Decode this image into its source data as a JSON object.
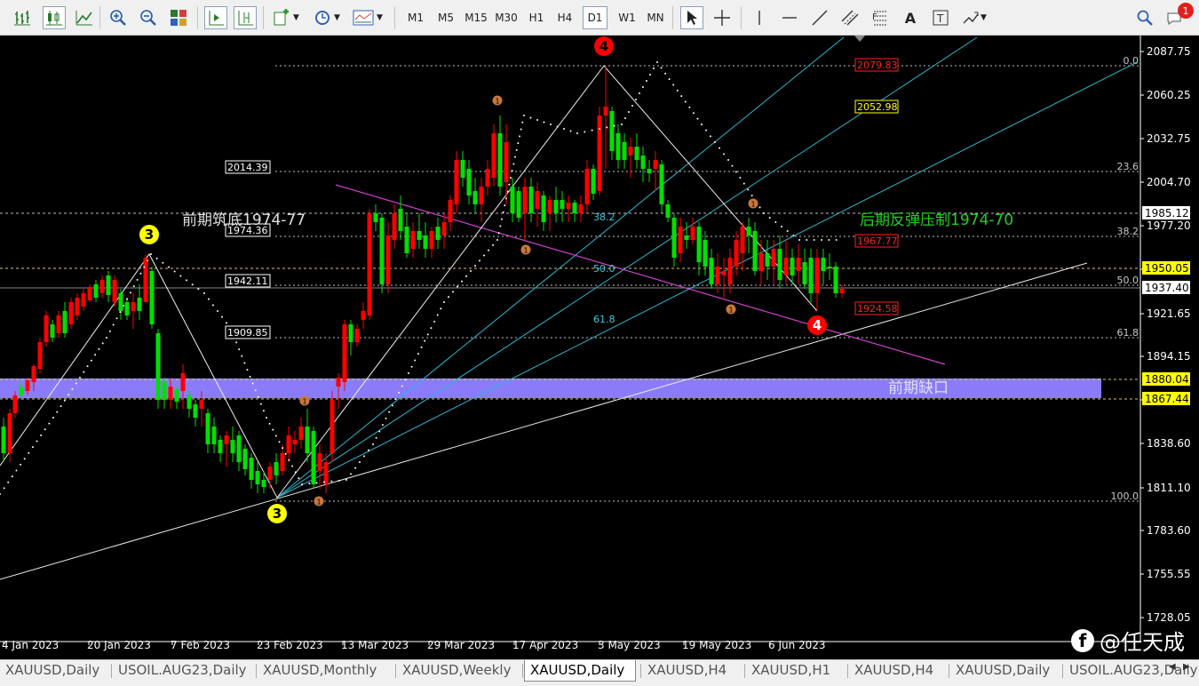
{
  "toolbar": {
    "timeframes": [
      "M1",
      "M5",
      "M15",
      "M30",
      "H1",
      "H4",
      "D1",
      "W1",
      "MN"
    ],
    "active_timeframe": "D1",
    "notification_count": "1",
    "text_tool_label": "A",
    "icons": [
      "bar-chart-icon",
      "candlestick-icon",
      "line-chart-icon",
      "zoom-in-icon",
      "zoom-out-icon",
      "tile-windows-icon",
      "autoscroll-icon",
      "chart-shift-icon",
      "new-order-icon",
      "history-clock-icon",
      "templates-icon",
      "cursor-icon",
      "crosshair-icon",
      "vertical-line-icon",
      "horizontal-line-icon",
      "trendline-icon",
      "equidistant-channel-icon",
      "fibonacci-icon",
      "text-label-icon",
      "shapes-icon",
      "search-icon"
    ]
  },
  "chart": {
    "symbol": "XAUUSD",
    "timeframe": "Daily",
    "current_price": "1937.40",
    "price_axis": [
      "2087.75",
      "2060.25",
      "2032.75",
      "2004.70",
      "1977.20",
      "1949.70",
      "1921.65",
      "1894.15",
      "1866.10",
      "1838.60",
      "1811.10",
      "1783.60",
      "1755.55",
      "1728.05"
    ],
    "date_axis": [
      "4 Jan 2023",
      "20 Jan 2023",
      "7 Feb 2023",
      "23 Feb 2023",
      "13 Mar 2023",
      "29 Mar 2023",
      "17 Apr 2023",
      "3 May 2023",
      "19 May 2023",
      "6 Jun 2023"
    ],
    "price_tags": [
      {
        "text": "1985.12",
        "style": "white"
      },
      {
        "text": "1950.05",
        "style": "yellow"
      },
      {
        "text": "1937.40",
        "style": "white"
      },
      {
        "text": "1880.04",
        "style": "yellow"
      },
      {
        "text": "1867.44",
        "style": "yellow"
      }
    ],
    "level_boxes": [
      {
        "text": "2014.39"
      },
      {
        "text": "1974.36"
      },
      {
        "text": "1942.11"
      },
      {
        "text": "1909.85"
      }
    ],
    "fib_levels": [
      {
        "label": "0.0"
      },
      {
        "label": "23.6"
      },
      {
        "label": "38.2"
      },
      {
        "label": "50.0"
      },
      {
        "label": "61.8"
      },
      {
        "label": "100.0"
      }
    ],
    "fan_labels": [
      "38.2",
      "50.0",
      "61.8"
    ],
    "target_boxes": [
      {
        "text": "2079.83",
        "color": "#ff2020"
      },
      {
        "text": "2052.98",
        "color": "#ffff00"
      },
      {
        "text": "1967.77",
        "color": "#ff2020"
      },
      {
        "text": "1924.58",
        "color": "#ff2020"
      }
    ],
    "annotations": {
      "previous_bottom": "前期筑底1974-77",
      "rebound_pressure": "后期反弹压制1974-70",
      "previous_gap": "前期缺口"
    },
    "wave_labels": [
      "3",
      "3",
      "4",
      "4"
    ],
    "small_markers": [
      "1",
      "1",
      "1",
      "1",
      "1",
      "1"
    ],
    "colors": {
      "bull": "#00e000",
      "bear": "#ff0000",
      "fib": "#c0c0c0",
      "fan": "#2bb8d0",
      "channel": "#d040d0",
      "gap_zone": "#8a7cf8"
    }
  },
  "tabs": [
    "XAUUSD,Daily",
    "USOIL.AUG23,Daily",
    "XAUUSD,Monthly",
    "XAUUSD,Weekly",
    "XAUUSD,Daily",
    "XAUUSD,H4",
    "XAUUSD,H1",
    "XAUUSD,H4",
    "XAUUSD,Daily",
    "USOIL.AUG23,Daily"
  ],
  "active_tab_index": 4,
  "watermark": "@任天成",
  "watermark_logo": "f"
}
